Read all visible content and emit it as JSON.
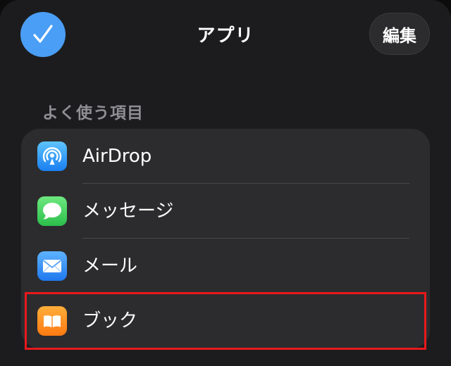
{
  "header": {
    "title": "アプリ",
    "edit_label": "編集",
    "done_icon": "checkmark-icon"
  },
  "section": {
    "title": "よく使う項目",
    "items": [
      {
        "label": "AirDrop",
        "icon": "airdrop-icon",
        "color": "#1a8cf0"
      },
      {
        "label": "メッセージ",
        "icon": "messages-icon",
        "color": "#34c759"
      },
      {
        "label": "メール",
        "icon": "mail-icon",
        "color": "#2f8cf4"
      },
      {
        "label": "ブック",
        "icon": "books-icon",
        "color": "#ff8c1a"
      }
    ]
  },
  "colors": {
    "background": "#1c1c1e",
    "card": "#2c2c2e",
    "accent": "#4a9ef5",
    "highlight": "#e8191d"
  }
}
